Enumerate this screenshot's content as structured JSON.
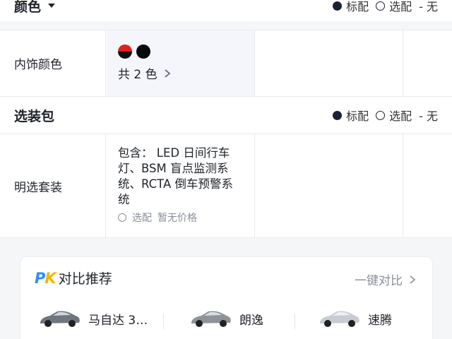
{
  "color_section": {
    "title": "颜色",
    "title_suffix_icon": "caret-down-icon",
    "legend": {
      "standard": "标配",
      "optional": "选配",
      "none": "- 无"
    }
  },
  "interior_color_row": {
    "label": "内饰颜色",
    "swatches": [
      "#e02020/#111111",
      "#0a0a0a"
    ],
    "count_text": "共 2 色",
    "chevron_icon": "chevron-right-icon"
  },
  "options_section": {
    "title": "选装包",
    "legend": {
      "standard": "标配",
      "optional": "选配",
      "none": "- 无"
    }
  },
  "package_row": {
    "label": "明选套装",
    "description": "包含： LED 日间行车灯、BSM 盲点监测系统、RCTA 倒车预警系统",
    "status_label": "选配",
    "price_text": "暂无价格"
  },
  "compare_card": {
    "logo_text_p": "P",
    "logo_text_k": "K",
    "title": "对比推荐",
    "action_label": "一键对比",
    "cars": [
      {
        "name": "马自达 3…",
        "color": "#6f7680"
      },
      {
        "name": "朗逸",
        "color": "#8e9399"
      },
      {
        "name": "速腾",
        "color": "#c7ccd3"
      }
    ]
  }
}
